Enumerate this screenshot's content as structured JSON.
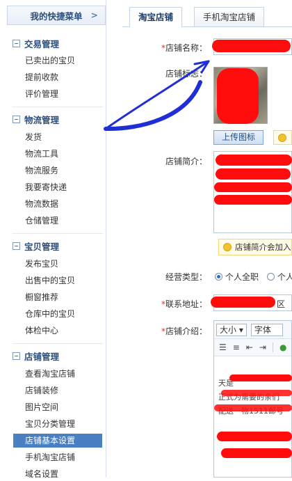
{
  "sidebar": {
    "quick_menu": "我的快捷菜单",
    "quick_chevron": ">",
    "groups": [
      {
        "title": "交易管理",
        "items": [
          "已卖出的宝贝",
          "提前收款",
          "评价管理"
        ]
      },
      {
        "title": "物流管理",
        "items": [
          "发货",
          "物流工具",
          "物流服务",
          "我要寄快递",
          "物流数据",
          "仓储管理"
        ]
      },
      {
        "title": "宝贝管理",
        "items": [
          "发布宝贝",
          "出售中的宝贝",
          "橱窗推荐",
          "仓库中的宝贝",
          "体检中心"
        ]
      },
      {
        "title": "店铺管理",
        "items": [
          "查看淘宝店铺",
          "店铺装修",
          "图片空间",
          "宝贝分类管理",
          "店铺基本设置",
          "手机淘宝店铺",
          "域名设置"
        ]
      }
    ],
    "active_item": "店铺基本设置"
  },
  "tabs": [
    {
      "label": "淘宝店铺"
    },
    {
      "label": "手机淘宝店铺"
    }
  ],
  "form": {
    "required_mark": "*",
    "shop_name_label": "店铺名称：",
    "shop_logo_label": "店铺标志：",
    "upload_button": "上传图标",
    "shop_intro_label": "店铺简介：",
    "intro_tip": "店铺简介会加入",
    "business_type_label": "经营类型：",
    "business_type_options": [
      "个人全职",
      "个人"
    ],
    "business_type_selected": "个人全职",
    "address_label": "联系地址：",
    "address_visible": "区",
    "description_label": "店铺介绍：",
    "editor": {
      "size_select": "大小",
      "font_select": "字体",
      "text_fragments": [
        "天是",
        "正式为需要的亲们",
        "配送一物1511邮号"
      ]
    }
  },
  "colors": {
    "annotation_arrow": "#1f2fd6",
    "redaction": "#ff0d0d",
    "active_nav": "#4a7fc1"
  }
}
